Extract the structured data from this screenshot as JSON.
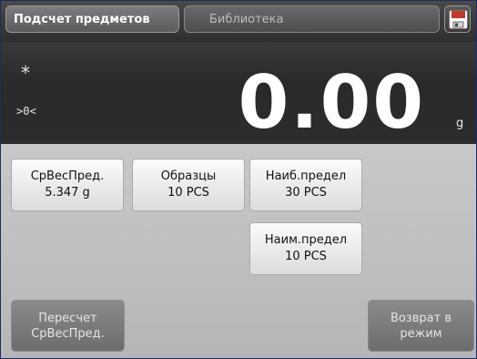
{
  "header": {
    "app_tab": "Подсчет предметов",
    "library_tab": "Библиотека",
    "save_icon": "save-icon"
  },
  "display": {
    "stability_indicator": "*",
    "zero_indicator": ">0<",
    "weight": "0.00",
    "unit": "g"
  },
  "params": {
    "apw": {
      "label": "СрВесПред.",
      "value": "5.347 g"
    },
    "samples": {
      "label": "Образцы",
      "value": "10 PCS"
    },
    "max_limit": {
      "label": "Наиб.предел",
      "value": "30 PCS"
    },
    "min_limit": {
      "label": "Наим.предел",
      "value": "10 PCS"
    }
  },
  "actions": {
    "recalc_line1": "Пересчет",
    "recalc_line2": "СрВесПред.",
    "back_line1": "Возврат в",
    "back_line2": "режим"
  }
}
